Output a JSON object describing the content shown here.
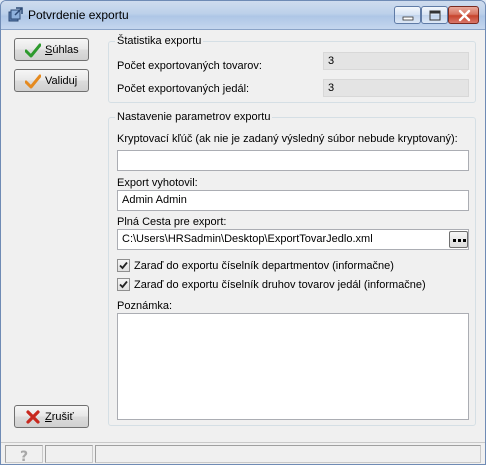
{
  "window": {
    "title": "Potvrdenie exportu"
  },
  "buttons": {
    "suhlas_prefix": "S",
    "suhlas_rest": "úhlas",
    "validuj": "Validuj",
    "zrusit_prefix": "Z",
    "zrusit_rest": "rušiť"
  },
  "stats": {
    "title": "Štatistika exportu",
    "tovary_label": "Počet exportovaných tovarov:",
    "tovary_value": "3",
    "jedla_label": "Počet exportovaných jedál:",
    "jedla_value": "3"
  },
  "params": {
    "title": "Nastavenie parametrov exportu",
    "key_label": "Kryptovací kľúč (ak nie je zadaný výsledný súbor nebude kryptovaný):",
    "key_value": "",
    "author_label": "Export vyhotovil:",
    "author_value": "Admin Admin",
    "path_label": "Plná Cesta pre export:",
    "path_value": "C:\\Users\\HRSadmin\\Desktop\\ExportTovarJedlo.xml",
    "check1_label": "Zaraď do exportu číselník departmentov (informačne)",
    "check1_checked": true,
    "check2_label": "Zaraď do exportu číselník druhov tovarov jedál (informačne)",
    "check2_checked": true,
    "note_label": "Poznámka:",
    "note_value": ""
  },
  "icons": {
    "app": "export-app-icon",
    "suhlas": "green-check-icon",
    "validuj": "orange-check-icon",
    "zrusit": "red-x-icon",
    "help": "help-question-icon",
    "browse": "ellipsis-icon"
  },
  "colors": {
    "accent_green": "#2e9a2e",
    "accent_orange": "#e58a1f",
    "accent_red": "#c8281e"
  }
}
